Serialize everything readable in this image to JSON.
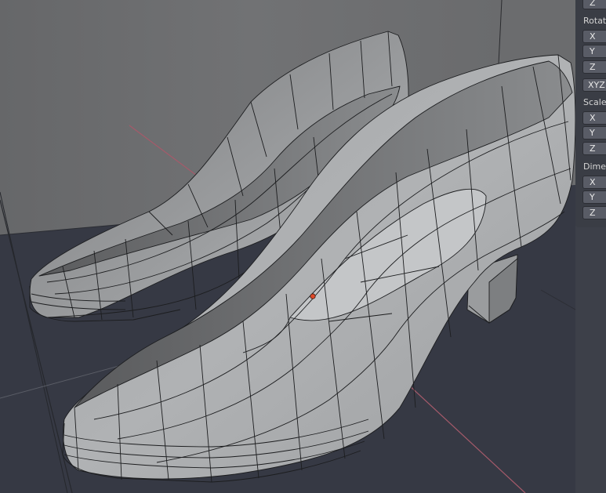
{
  "viewport": {
    "model": "shoe-pair-wireframe",
    "colors": {
      "background": "#3d4049",
      "wall": "#6e6f71",
      "floor": "#363944",
      "mesh": "#a7a9ab",
      "edge": "#1c1d1f",
      "x_axis": "#a55a6a",
      "origin": "#e04a2a"
    }
  },
  "panel": {
    "location": {
      "z": "Z"
    },
    "rotation": {
      "label": "Rotati",
      "x": "X",
      "y": "Y",
      "z": "Z",
      "mode": "XYZ"
    },
    "scale": {
      "label": "Scale:",
      "x": "X",
      "y": "Y",
      "z": "Z"
    },
    "dimensions": {
      "label": "Dimer",
      "x": "X",
      "y": "Y",
      "z": "Z"
    }
  }
}
